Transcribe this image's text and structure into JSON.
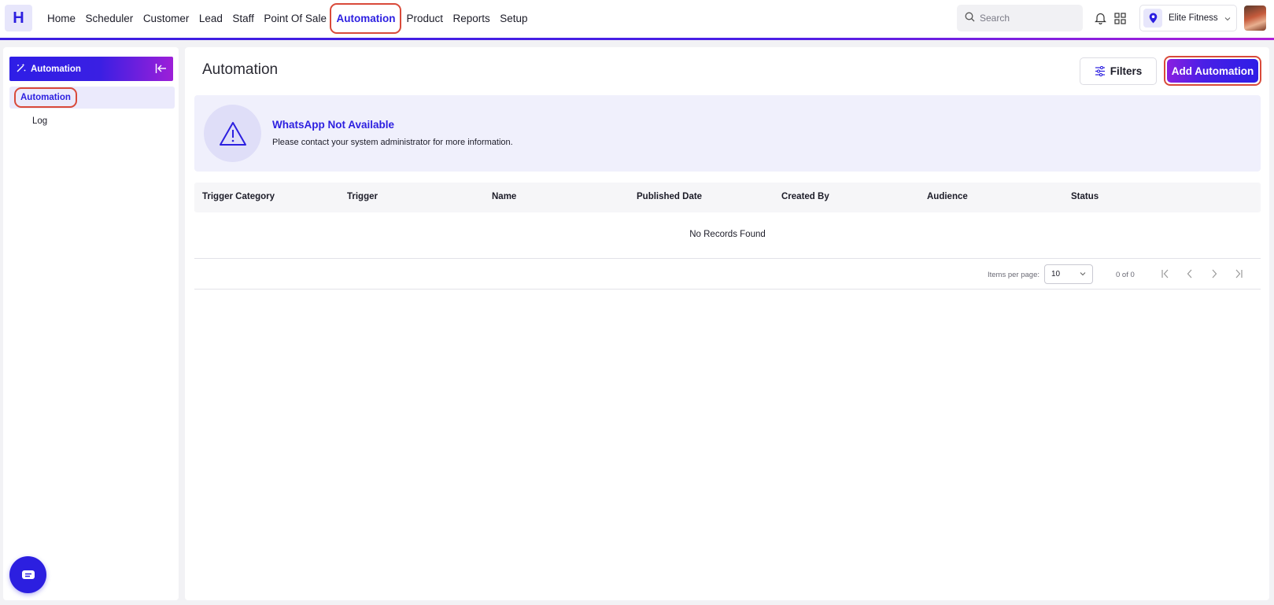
{
  "app": {
    "logo_letter": "H",
    "brand_color": "#2c1fe0",
    "highlight_color": "#d94a3a"
  },
  "nav": {
    "items": [
      {
        "label": "Home"
      },
      {
        "label": "Scheduler"
      },
      {
        "label": "Customer"
      },
      {
        "label": "Lead"
      },
      {
        "label": "Staff"
      },
      {
        "label": "Point Of Sale"
      },
      {
        "label": "Automation",
        "active": true
      },
      {
        "label": "Product"
      },
      {
        "label": "Reports"
      },
      {
        "label": "Setup"
      }
    ]
  },
  "header": {
    "search_placeholder": "Search",
    "icons": [
      "search-icon",
      "bell-icon",
      "apps-grid-icon",
      "location-pin-icon",
      "chevron-down-icon"
    ],
    "location_name": "Elite Fitness"
  },
  "sidebar": {
    "title": "Automation",
    "items": [
      {
        "label": "Automation",
        "active": true
      },
      {
        "label": "Log"
      }
    ]
  },
  "main": {
    "title": "Automation",
    "filters_label": "Filters",
    "add_label": "Add Automation",
    "alert": {
      "title": "WhatsApp Not Available",
      "message": "Please contact your system administrator for more information."
    },
    "table": {
      "columns": [
        "Trigger Category",
        "Trigger",
        "Name",
        "Published Date",
        "Created By",
        "Audience",
        "Status"
      ],
      "rows": [],
      "empty_text": "No Records Found"
    },
    "pagination": {
      "items_per_page_label": "Items per page:",
      "items_per_page": "10",
      "range": "0 of 0"
    }
  }
}
